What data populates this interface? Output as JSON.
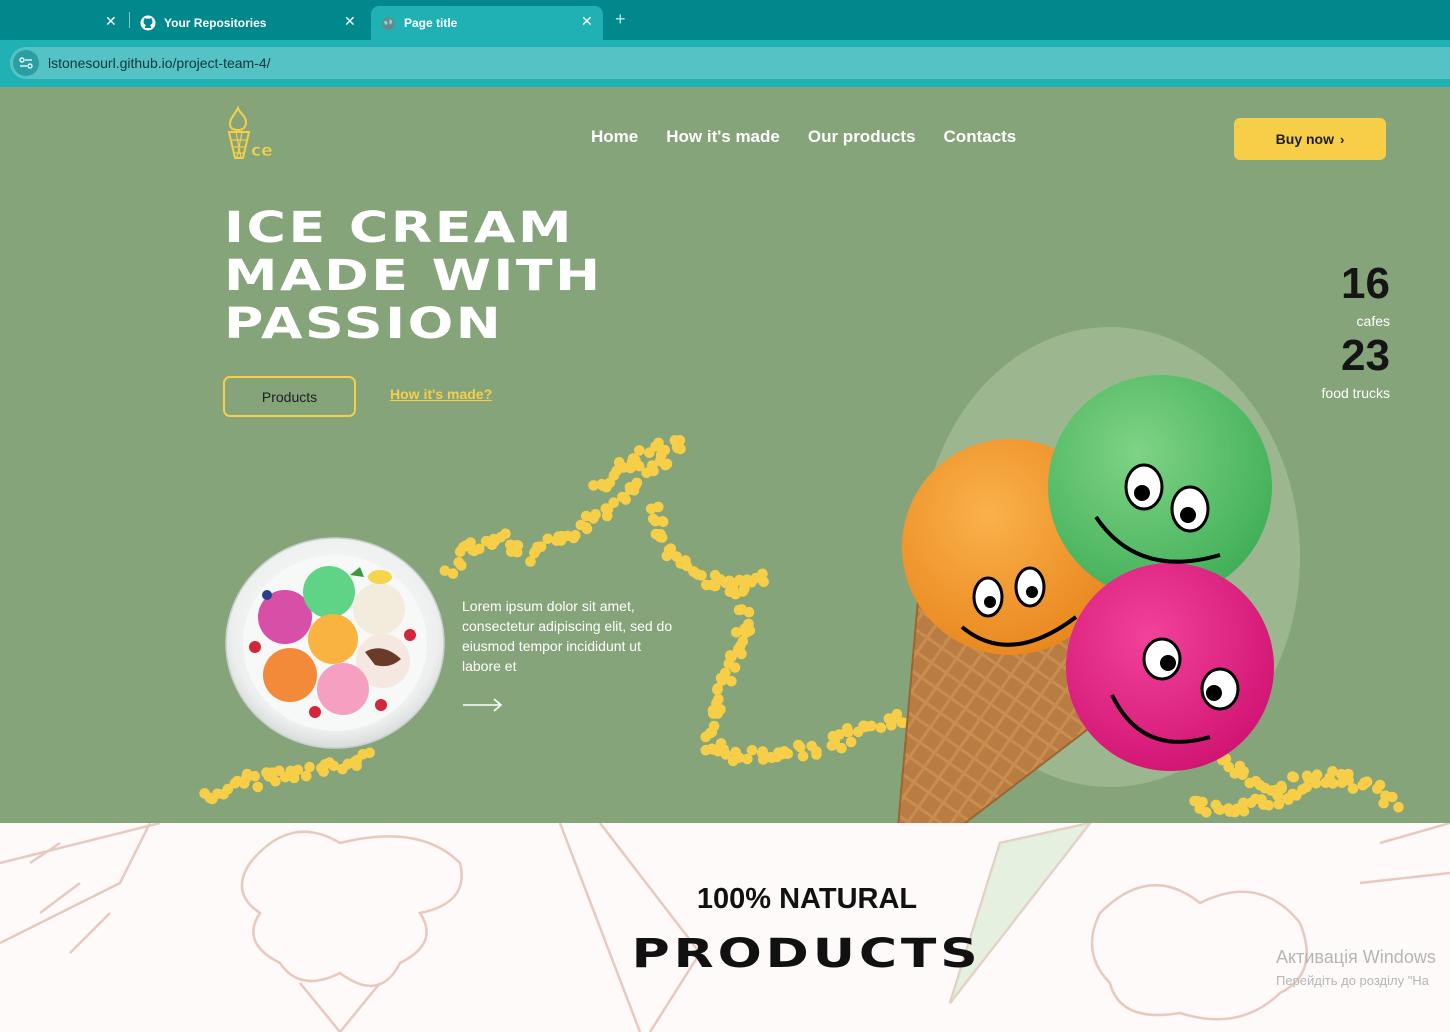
{
  "browser": {
    "tabs": [
      {
        "title": "",
        "active": false
      },
      {
        "title": "Your Repositories",
        "active": false,
        "icon": "github-icon"
      },
      {
        "title": "Page title",
        "active": true,
        "icon": "globe-icon"
      }
    ],
    "url": "lstonesourl.github.io/project-team-4/"
  },
  "header": {
    "logo_text": "ce",
    "nav": [
      "Home",
      "How it's made",
      "Our products",
      "Contacts"
    ],
    "buy_label": "Buy now"
  },
  "hero": {
    "headline": [
      "ICE CREAM",
      "MADE WITH",
      "PASSION"
    ],
    "products_button": "Products",
    "how_link": "How it's made?",
    "lorem": "Lorem ipsum dolor sit amet, consectetur adipiscing elit, sed do eiusmod tempor incididunt ut labore et",
    "stats": [
      {
        "number": "16",
        "label": "cafes"
      },
      {
        "number": "23",
        "label": "food trucks"
      }
    ]
  },
  "natural": {
    "subtitle": "100% NATURAL",
    "title": "PRODUCTS"
  },
  "system": {
    "watermark_line1": "Активація Windows",
    "watermark_line2": "Перейдіть до розділу \"На"
  },
  "colors": {
    "tabbar": "#00888c",
    "address_bar": "#1fb1b4",
    "hero_bg": "#86a47a",
    "accent_yellow": "#f7ce48",
    "section_bg": "#fdfaf9"
  }
}
